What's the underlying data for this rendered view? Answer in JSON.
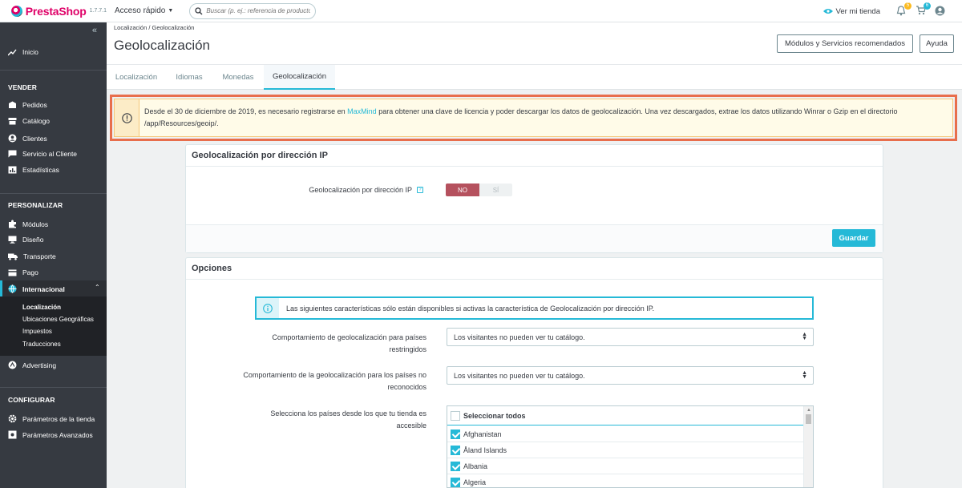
{
  "topbar": {
    "logo_text": "PrestaShop",
    "version": "1.7.7.1",
    "quick_access": "Acceso rápido",
    "search_placeholder": "Buscar (p. ej.: referencia de producto, n",
    "view_store": "Ver mi tienda",
    "notif_count_orders": "5",
    "notif_count_customers": "6"
  },
  "sidebar": {
    "inicio": "Inicio",
    "sec_vender": "VENDER",
    "pedidos": "Pedidos",
    "catalogo": "Catálogo",
    "clientes": "Clientes",
    "servicio": "Servicio al Cliente",
    "estadisticas": "Estadísticas",
    "sec_personalizar": "PERSONALIZAR",
    "modulos": "Módulos",
    "diseno": "Diseño",
    "transporte": "Transporte",
    "pago": "Pago",
    "internacional": "Internacional",
    "sub": [
      "Localización",
      "Ubicaciones Geográficas",
      "Impuestos",
      "Traducciones"
    ],
    "advertising": "Advertising",
    "sec_configurar": "CONFIGURAR",
    "parametros_tienda": "Parámetros de la tienda",
    "parametros_avanzados": "Parámetros Avanzados"
  },
  "header": {
    "breadcrumb": "Localización  /  Geolocalización",
    "title": "Geolocalización",
    "btn_modules": "Módulos y Servicios recomendados",
    "btn_help": "Ayuda"
  },
  "tabs": [
    "Localización",
    "Idiomas",
    "Monedas",
    "Geolocalización"
  ],
  "warning": {
    "text_before": "Desde el 30 de diciembre de 2019, es necesario registrarse en ",
    "link": "MaxMind",
    "text_after": " para obtener una clave de licencia y poder descargar los datos de geolocalización. Una vez descargados, extrae los datos utilizando Winrar o Gzip en el directorio /app/Resources/geoip/."
  },
  "panel_ip": {
    "title": "Geolocalización por dirección IP",
    "label": "Geolocalización por dirección IP",
    "help": "?",
    "toggle_no": "NO",
    "toggle_si": "SÍ",
    "save": "Guardar"
  },
  "panel_options": {
    "title": "Opciones",
    "info": "Las siguientes características sólo están disponibles si activas la característica de Geolocalización por dirección IP.",
    "label_restricted": "Comportamiento de geolocalización para países restringidos",
    "select_restricted": "Los visitantes no pueden ver tu catálogo.",
    "label_unrecognized": "Comportamiento de la geolocalización para los países no reconocidos",
    "select_unrecognized": "Los visitantes no pueden ver tu catálogo.",
    "label_countries": "Selecciona los países desde los que tu tienda es accesible",
    "select_all": "Seleccionar todos",
    "countries": [
      "Afghanistan",
      "Åland Islands",
      "Albania",
      "Algeria"
    ]
  },
  "colors": {
    "accent": "#25b9d7",
    "brand": "#df0067",
    "sidebar_bg": "#363a41",
    "toggle_no": "#b5515e",
    "warning_border": "#e86e4c"
  }
}
